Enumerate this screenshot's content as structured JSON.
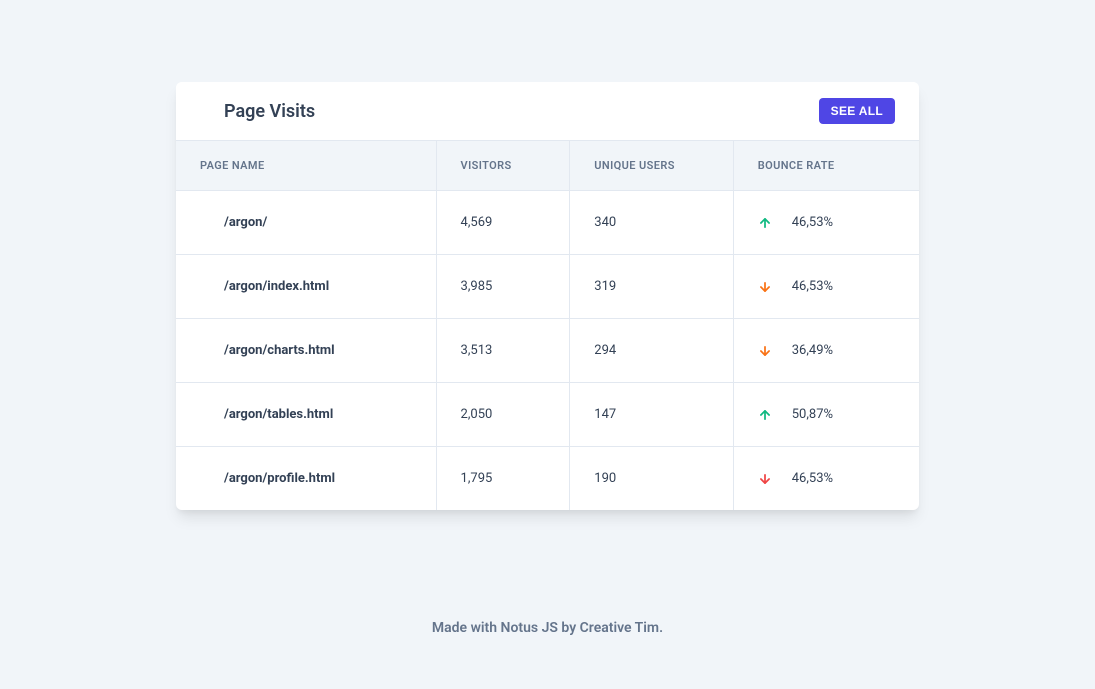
{
  "card": {
    "title": "Page Visits",
    "see_all": "See all"
  },
  "columns": {
    "page_name": "Page name",
    "visitors": "Visitors",
    "unique_users": "Unique users",
    "bounce_rate": "Bounce rate"
  },
  "rows": [
    {
      "page": "/argon/",
      "visitors": "4,569",
      "unique": "340",
      "bounce": "46,53%",
      "trend": "up-green"
    },
    {
      "page": "/argon/index.html",
      "visitors": "3,985",
      "unique": "319",
      "bounce": "46,53%",
      "trend": "down-orange"
    },
    {
      "page": "/argon/charts.html",
      "visitors": "3,513",
      "unique": "294",
      "bounce": "36,49%",
      "trend": "down-orange"
    },
    {
      "page": "/argon/tables.html",
      "visitors": "2,050",
      "unique": "147",
      "bounce": "50,87%",
      "trend": "up-green"
    },
    {
      "page": "/argon/profile.html",
      "visitors": "1,795",
      "unique": "190",
      "bounce": "46,53%",
      "trend": "down-red"
    }
  ],
  "footer": {
    "prefix": "Made with ",
    "link1": "Notus JS",
    "mid": " by ",
    "link2": "Creative Tim",
    "suffix": "."
  },
  "colors": {
    "accent": "#4f46e5",
    "up": "#10b981",
    "down_orange": "#f97316",
    "down_red": "#ef4444"
  }
}
